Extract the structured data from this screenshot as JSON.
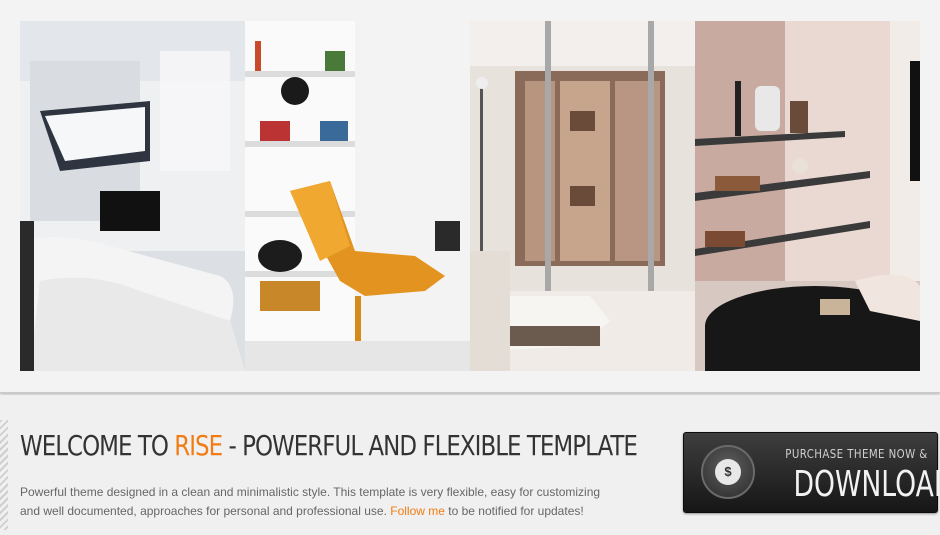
{
  "slider": {
    "panels": [
      {
        "name": "white-living-room"
      },
      {
        "name": "bookshelf-orange-chair"
      },
      {
        "name": "glass-wardrobe-room"
      },
      {
        "name": "shelves-black-ottoman"
      }
    ]
  },
  "welcome": {
    "title_prefix": "WELCOME TO ",
    "title_accent": "RISE",
    "title_suffix": " - POWERFUL AND FLEXIBLE TEMPLATE",
    "description_line1": "Powerful theme designed in a clean and minimalistic style. This template is very flexible, easy for customizing",
    "description_line2_before": "and well documented, approaches for personal and professional use. ",
    "follow_link": "Follow me",
    "description_line2_after": " to be notified for updates!"
  },
  "download_button": {
    "top_label": "PURCHASE THEME NOW &",
    "main_label": "DOWNLOAD",
    "coin_symbol": "$",
    "icon": "coins-icon"
  },
  "colors": {
    "accent": "#f07c13",
    "text": "#333333",
    "button_bg": "#1e1e1e"
  }
}
